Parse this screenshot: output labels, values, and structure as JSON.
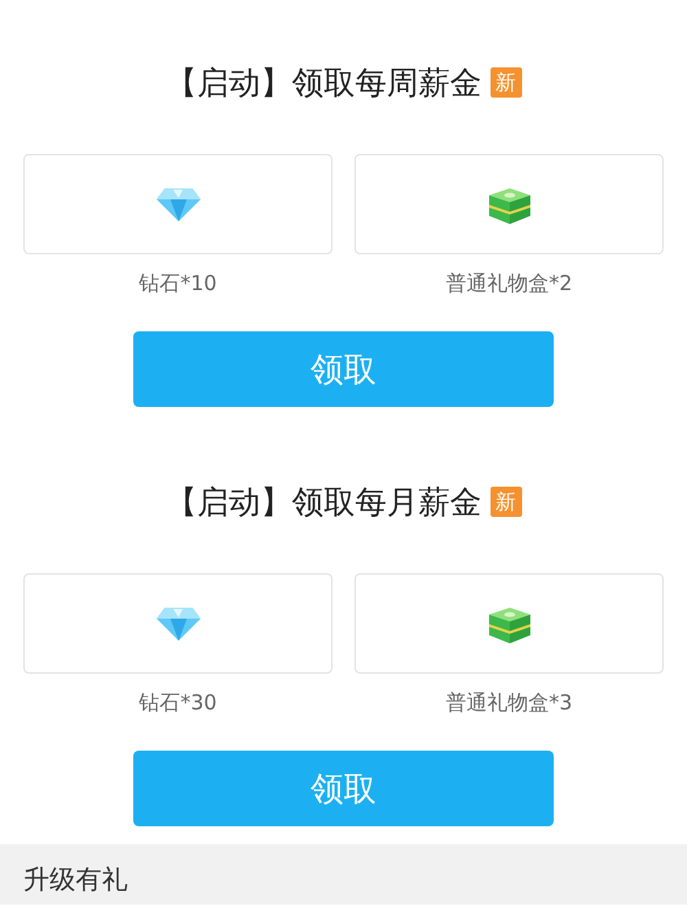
{
  "sections": [
    {
      "title": "【启动】领取每周薪金",
      "badge": "新",
      "rewards": [
        {
          "kind": "diamond",
          "label": "钻石*10"
        },
        {
          "kind": "giftbox",
          "label": "普通礼物盒*2"
        }
      ],
      "button": "领取"
    },
    {
      "title": "【启动】领取每月薪金",
      "badge": "新",
      "rewards": [
        {
          "kind": "diamond",
          "label": "钻石*30"
        },
        {
          "kind": "giftbox",
          "label": "普通礼物盒*3"
        }
      ],
      "button": "领取"
    }
  ],
  "footer": {
    "title": "升级有礼"
  }
}
